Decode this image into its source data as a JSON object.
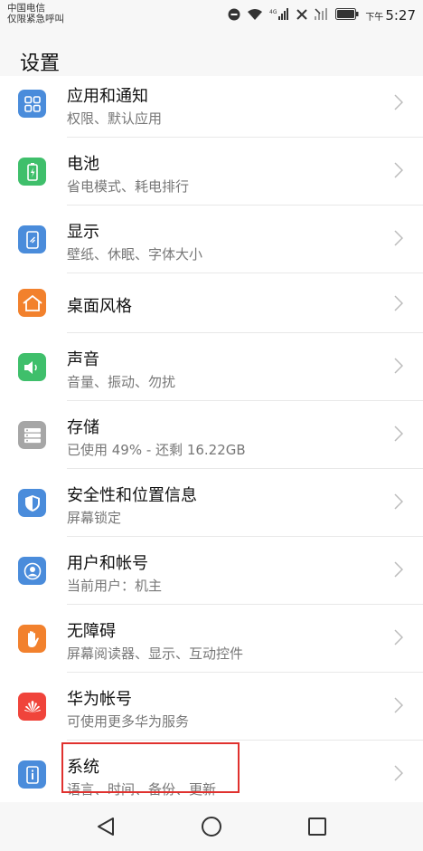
{
  "status": {
    "carrier_line1": "中国电信",
    "carrier_line2": "仅限紧急呼叫",
    "time_prefix": "下午",
    "time": "5:27"
  },
  "header": {
    "title": "设置"
  },
  "items": [
    {
      "title": "应用和通知",
      "subtitle": "权限、默认应用",
      "icon": "apps-icon",
      "color": "#4a8cdb"
    },
    {
      "title": "电池",
      "subtitle": "省电模式、耗电排行",
      "icon": "battery-icon",
      "color": "#3fbf6b"
    },
    {
      "title": "显示",
      "subtitle": "壁纸、休眠、字体大小",
      "icon": "display-icon",
      "color": "#4a8cdb"
    },
    {
      "title": "桌面风格",
      "subtitle": "",
      "icon": "home-icon",
      "color": "#f2812d"
    },
    {
      "title": "声音",
      "subtitle": "音量、振动、勿扰",
      "icon": "sound-icon",
      "color": "#3fbf6b"
    },
    {
      "title": "存储",
      "subtitle": "已使用 49% - 还剩 16.22GB",
      "icon": "storage-icon",
      "color": "#a6a6a6"
    },
    {
      "title": "安全性和位置信息",
      "subtitle": "屏幕锁定",
      "icon": "shield-icon",
      "color": "#4a8cdb"
    },
    {
      "title": "用户和帐号",
      "subtitle": "当前用户：机主",
      "icon": "user-icon",
      "color": "#4a8cdb"
    },
    {
      "title": "无障碍",
      "subtitle": "屏幕阅读器、显示、互动控件",
      "icon": "hand-icon",
      "color": "#f2812d"
    },
    {
      "title": "华为帐号",
      "subtitle": "可使用更多华为服务",
      "icon": "huawei-icon",
      "color": "#f0443b"
    },
    {
      "title": "系统",
      "subtitle": "语言、时间、备份、更新",
      "icon": "system-icon",
      "color": "#4a8cdb"
    }
  ]
}
